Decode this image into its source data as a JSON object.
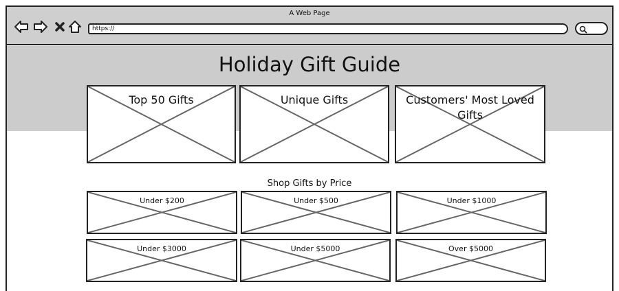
{
  "browser": {
    "window_title": "A Web Page",
    "url": "https://",
    "icons": [
      "back-icon",
      "forward-icon",
      "close-icon",
      "home-icon",
      "search-icon"
    ]
  },
  "page": {
    "title": "Holiday Gift Guide",
    "featured": [
      {
        "label": "Top 50 Gifts"
      },
      {
        "label": "Unique Gifts"
      },
      {
        "label": "Customers' Most Loved Gifts"
      }
    ],
    "price_section": {
      "heading": "Shop Gifts by Price",
      "tiles": [
        {
          "label": "Under $200"
        },
        {
          "label": "Under $500"
        },
        {
          "label": "Under $1000"
        },
        {
          "label": "Under $3000"
        },
        {
          "label": "Under $5000"
        },
        {
          "label": "Over $5000"
        }
      ]
    }
  },
  "colors": {
    "chrome": "#cfcfcf",
    "hero": "#cccccc",
    "stroke": "#222222",
    "placeholder_x": "#666666"
  }
}
